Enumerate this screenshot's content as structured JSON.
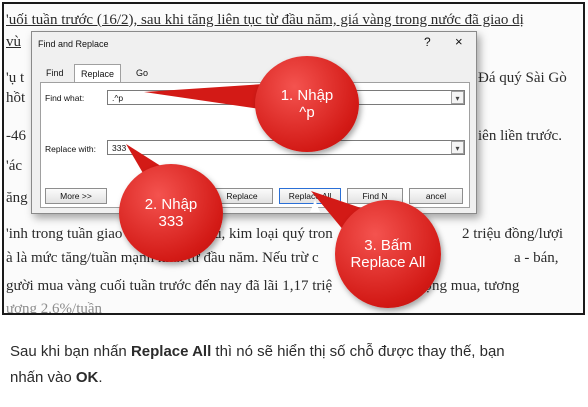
{
  "document": {
    "lines": [
      "'uối tuần trước (16/2), sau khi tăng liên tục từ đầu năm, giá vàng trong nước đã giao dị",
      "vù",
      "'ụ t",
      "Đá quý Sài Gò",
      "hồt",
      "-46",
      "iên liền trước.",
      "'ác",
      "ăng",
      "'inh trong tuần giao",
      "u, kim loại quý tron",
      "2 triệu đồng/lượi",
      "à là mức tăng/tuần mạnh nhất từ đầu năm. Nếu trừ c",
      "a - bán,",
      "gười mua vàng cuối tuần trước đến nay đã lãi 1,17 triệ",
      "ượng mua, tương",
      "ương 2,6%/tuần"
    ],
    "caption_parts": {
      "p1": "Sau khi bạn nhấn ",
      "b1": "Replace All",
      "p2": " thì nó sẽ hiển thị số chỗ được thay thế, bạn",
      "p3": "nhấn vào ",
      "b2": "OK",
      "p4": "."
    }
  },
  "dialog": {
    "title": "Find and Replace",
    "help": "?",
    "close": "×",
    "tabs": [
      "Find",
      "Replace",
      "Go To"
    ],
    "find_label": "Find what:",
    "find_value": ".^p",
    "replace_label": "Replace with:",
    "replace_value": "333",
    "buttons": {
      "more": "More >>",
      "replace": "Replace",
      "replace_all": "Replace All",
      "find_next": "Find N",
      "cancel": "ancel"
    }
  },
  "callouts": {
    "step1": [
      "1. Nhập",
      "^p"
    ],
    "step2": [
      "2. Nhập",
      "333"
    ],
    "step3": [
      "3. Bấm",
      "Replace All"
    ]
  },
  "colors": {
    "callout": "#d31a16",
    "dialog_bg": "#f0f0f0",
    "focus_border": "#2a6fd6"
  }
}
